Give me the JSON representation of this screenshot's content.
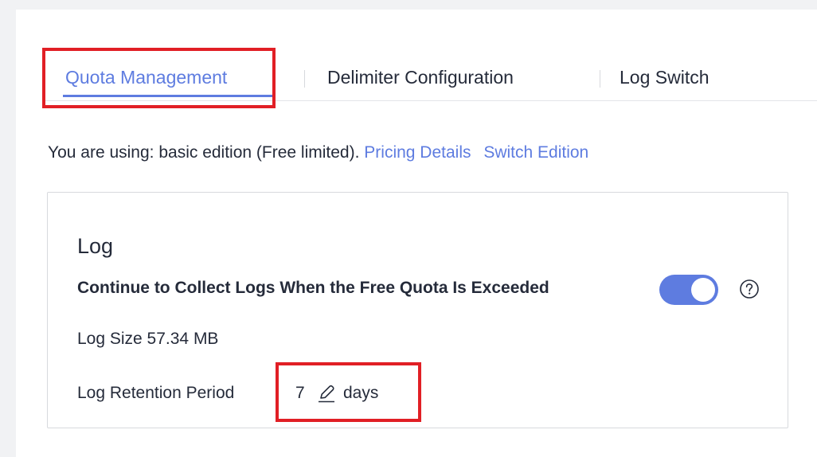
{
  "tabs": [
    {
      "label": "Quota Management",
      "active": true
    },
    {
      "label": "Delimiter Configuration",
      "active": false
    },
    {
      "label": "Log Switch",
      "active": false
    }
  ],
  "edition": {
    "text": "You are using: basic edition (Free limited).",
    "pricing_link": "Pricing Details",
    "switch_link": "Switch Edition"
  },
  "log_card": {
    "title": "Log",
    "collect_label": "Continue to Collect Logs When the Free Quota Is Exceeded",
    "collect_enabled": true,
    "size_label": "Log Size 57.34 MB",
    "retention_label": "Log Retention Period",
    "retention_value": "7",
    "retention_unit": "days"
  },
  "icons": {
    "help": "question-circle-icon",
    "edit": "pencil-edit-icon"
  },
  "colors": {
    "accent": "#5e7ce0",
    "highlight": "#e11f25",
    "text": "#252b3a",
    "border": "#d7d9dd"
  }
}
